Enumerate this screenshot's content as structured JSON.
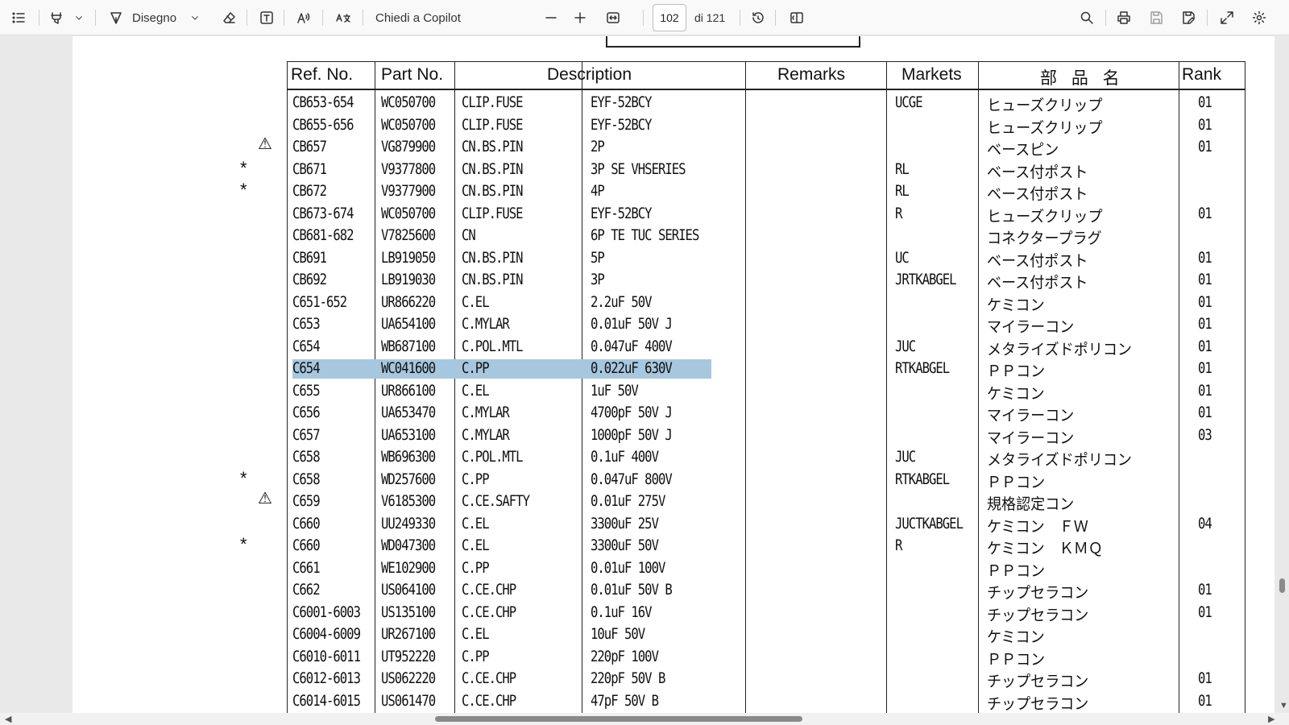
{
  "toolbar": {
    "draw_label": "Disegno",
    "copilot_label": "Chiedi a Copilot",
    "page_current": "102",
    "page_total": "di 121",
    "icons": [
      "contents-icon",
      "highlight-icon",
      "draw-icon",
      "eraser-icon",
      "text-box-icon",
      "read-aloud-icon",
      "translate-icon",
      "zoom-out-icon",
      "zoom-in-icon",
      "fit-width-icon",
      "rotate-icon",
      "page-view-icon",
      "search-icon",
      "print-icon",
      "save-icon",
      "save-as-icon",
      "expand-icon",
      "settings-icon"
    ]
  },
  "table": {
    "headers": {
      "ref": "Ref. No.",
      "part": "Part No.",
      "description": "Description",
      "remarks": "Remarks",
      "markets": "Markets",
      "name_jp": "部 品 名",
      "rank": "Rank"
    },
    "markers": {
      "star": "*",
      "warning": "⚠"
    },
    "rows": [
      {
        "ref": "CB653-654",
        "part": "WC050700",
        "d1": "CLIP.FUSE",
        "d2": "EYF-52BCY",
        "market": "UCGE",
        "jp": "ヒューズクリップ",
        "rank": "01",
        "marker": ""
      },
      {
        "ref": "CB655-656",
        "part": "WC050700",
        "d1": "CLIP.FUSE",
        "d2": "EYF-52BCY",
        "market": "",
        "jp": "ヒューズクリップ",
        "rank": "01",
        "marker": ""
      },
      {
        "ref": "CB657",
        "part": "VG879900",
        "d1": "CN.BS.PIN",
        "d2": "2P",
        "market": "",
        "jp": "ベースピン",
        "rank": "01",
        "marker": "warning"
      },
      {
        "ref": "CB671",
        "part": "V9377800",
        "d1": "CN.BS.PIN",
        "d2": "3P  SE VHSERIES",
        "market": "RL",
        "jp": "ベース付ポスト",
        "rank": "",
        "marker": "star"
      },
      {
        "ref": "CB672",
        "part": "V9377900",
        "d1": "CN.BS.PIN",
        "d2": "4P",
        "market": "RL",
        "jp": "ベース付ポスト",
        "rank": "",
        "marker": "star"
      },
      {
        "ref": "CB673-674",
        "part": "WC050700",
        "d1": "CLIP.FUSE",
        "d2": "EYF-52BCY",
        "market": "R",
        "jp": "ヒューズクリップ",
        "rank": "01",
        "marker": ""
      },
      {
        "ref": "CB681-682",
        "part": "V7825600",
        "d1": "CN",
        "d2": "6P  TE  TUC SERIES",
        "market": "",
        "jp": "コネクタープラグ",
        "rank": "",
        "marker": ""
      },
      {
        "ref": "CB691",
        "part": "LB919050",
        "d1": "CN.BS.PIN",
        "d2": "5P",
        "market": "UC",
        "jp": "ベース付ポスト",
        "rank": "01",
        "marker": ""
      },
      {
        "ref": "CB692",
        "part": "LB919030",
        "d1": "CN.BS.PIN",
        "d2": "3P",
        "market": "JRTKABGEL",
        "jp": "ベース付ポスト",
        "rank": "01",
        "marker": ""
      },
      {
        "ref": "C651-652",
        "part": "UR866220",
        "d1": "C.EL",
        "d2": "2.2uF      50V",
        "market": "",
        "jp": "ケミコン",
        "rank": "01",
        "marker": ""
      },
      {
        "ref": "C653",
        "part": "UA654100",
        "d1": "C.MYLAR",
        "d2": "0.01uF     50V J",
        "market": "",
        "jp": "マイラーコン",
        "rank": "01",
        "marker": ""
      },
      {
        "ref": "C654",
        "part": "WB687100",
        "d1": "C.POL.MTL",
        "d2": "0.047uF    400V",
        "market": "JUC",
        "jp": "メタライズドポリコン",
        "rank": "01",
        "marker": ""
      },
      {
        "ref": "C654",
        "part": "WC041600",
        "d1": "C.PP",
        "d2": "0.022uF    630V",
        "market": "RTKABGEL",
        "jp": "ＰＰコン",
        "rank": "01",
        "marker": "",
        "selected": true
      },
      {
        "ref": "C655",
        "part": "UR866100",
        "d1": "C.EL",
        "d2": "1uF        50V",
        "market": "",
        "jp": "ケミコン",
        "rank": "01",
        "marker": ""
      },
      {
        "ref": "C656",
        "part": "UA653470",
        "d1": "C.MYLAR",
        "d2": "4700pF     50V J",
        "market": "",
        "jp": "マイラーコン",
        "rank": "01",
        "marker": ""
      },
      {
        "ref": "C657",
        "part": "UA653100",
        "d1": "C.MYLAR",
        "d2": "1000pF     50V J",
        "market": "",
        "jp": "マイラーコン",
        "rank": "03",
        "marker": ""
      },
      {
        "ref": "C658",
        "part": "WB696300",
        "d1": "C.POL.MTL",
        "d2": "0.1uF      400V",
        "market": "JUC",
        "jp": "メタライズドポリコン",
        "rank": "",
        "marker": ""
      },
      {
        "ref": "C658",
        "part": "WD257600",
        "d1": "C.PP",
        "d2": "0.047uF    800V",
        "market": "RTKABGEL",
        "jp": "ＰＰコン",
        "rank": "",
        "marker": "star"
      },
      {
        "ref": "C659",
        "part": "V6185300",
        "d1": "C.CE.SAFTY",
        "d2": "0.01uF     275V",
        "market": "",
        "jp": "規格認定コン",
        "rank": "",
        "marker": "warning"
      },
      {
        "ref": "C660",
        "part": "UU249330",
        "d1": "C.EL",
        "d2": "3300uF     25V",
        "market": "JUCTKABGEL",
        "jp": "ケミコン　ＦＷ",
        "rank": "04",
        "marker": ""
      },
      {
        "ref": "C660",
        "part": "WD047300",
        "d1": "C.EL",
        "d2": "3300uF     50V",
        "market": "R",
        "jp": "ケミコン　ＫＭＱ",
        "rank": "",
        "marker": "star"
      },
      {
        "ref": "C661",
        "part": "WE102900",
        "d1": "C.PP",
        "d2": "0.01uF     100V",
        "market": "",
        "jp": "ＰＰコン",
        "rank": "",
        "marker": ""
      },
      {
        "ref": "C662",
        "part": "US064100",
        "d1": "C.CE.CHP",
        "d2": "0.01uF     50V B",
        "market": "",
        "jp": "チップセラコン",
        "rank": "01",
        "marker": ""
      },
      {
        "ref": "C6001-6003",
        "part": "US135100",
        "d1": "C.CE.CHP",
        "d2": "0.1uF      16V",
        "market": "",
        "jp": "チップセラコン",
        "rank": "01",
        "marker": ""
      },
      {
        "ref": "C6004-6009",
        "part": "UR267100",
        "d1": "C.EL",
        "d2": "10uF       50V",
        "market": "",
        "jp": "ケミコン",
        "rank": "",
        "marker": ""
      },
      {
        "ref": "C6010-6011",
        "part": "UT952220",
        "d1": "C.PP",
        "d2": "220pF      100V",
        "market": "",
        "jp": "ＰＰコン",
        "rank": "",
        "marker": ""
      },
      {
        "ref": "C6012-6013",
        "part": "US062220",
        "d1": "C.CE.CHP",
        "d2": "220pF      50V B",
        "market": "",
        "jp": "チップセラコン",
        "rank": "01",
        "marker": ""
      },
      {
        "ref": "C6014-6015",
        "part": "US061470",
        "d1": "C.CE.CHP",
        "d2": "47pF       50V B",
        "market": "",
        "jp": "チップセラコン",
        "rank": "01",
        "marker": ""
      }
    ]
  }
}
